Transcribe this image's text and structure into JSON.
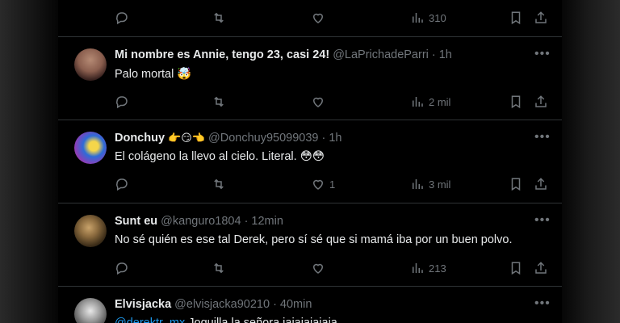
{
  "top_actions": {
    "views": "310"
  },
  "tweets": [
    {
      "name": "Mi nombre es Annie, tengo 23, casi 24!",
      "handle": "@LaPrichadeParri",
      "time": "1h",
      "text": "Palo mortal 🤯",
      "replies": "",
      "retweets": "",
      "likes": "",
      "views": "2 mil"
    },
    {
      "name": "Donchuy",
      "name_emoji": "👉😏👈",
      "handle": "@Donchuy95099039",
      "time": "1h",
      "text": "El colágeno la llevo al cielo. Literal. 😳😳",
      "replies": "",
      "retweets": "",
      "likes": "1",
      "views": "3 mil"
    },
    {
      "name": "Sunt eu",
      "handle": "@kanguro1804",
      "time": "12min",
      "text": "No sé quién es ese tal Derek, pero sí sé que si mamá iba por un buen polvo.",
      "replies": "",
      "retweets": "",
      "likes": "",
      "views": "213"
    },
    {
      "name": "Elvisjacka",
      "handle": "@elvisjacka90210",
      "time": "40min",
      "mention": "@derektr_mx",
      "text": "Joguilla la señora jajajajajaja"
    }
  ],
  "icons": {
    "reply": "reply-icon",
    "retweet": "retweet-icon",
    "like": "heart-icon",
    "views": "views-icon",
    "bookmark": "bookmark-icon",
    "share": "share-icon",
    "more": "more-icon"
  },
  "colors": {
    "background": "#000000",
    "text": "#e7e9ea",
    "secondary": "#71767b",
    "link": "#1d9bf0",
    "divider": "#2f3336"
  }
}
